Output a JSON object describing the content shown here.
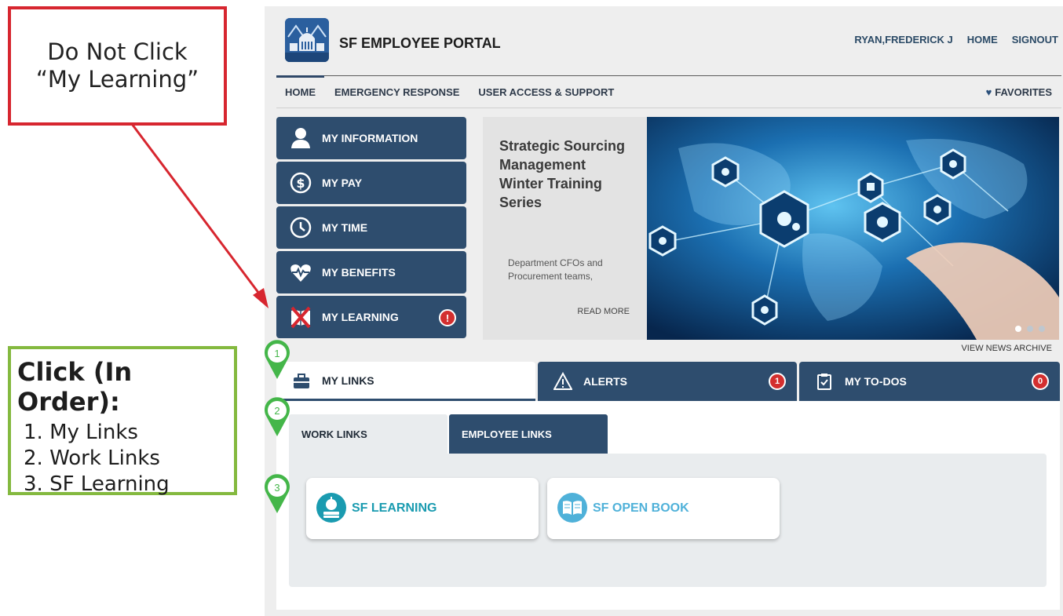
{
  "annotations": {
    "do_not_click": [
      "Do Not Click",
      "“My Learning”"
    ],
    "click_heading": "Click (In Order):",
    "steps": [
      "1. My Links",
      "2. Work Links",
      "3. SF Learning"
    ],
    "pins": [
      "1",
      "2",
      "3"
    ],
    "colors": {
      "red": "#d7262f",
      "green": "#84b93f",
      "pin": "#44b649"
    }
  },
  "header": {
    "brand": "SF EMPLOYEE PORTAL",
    "user": "RYAN,FREDERICK J",
    "home": "HOME",
    "signout": "SIGNOUT"
  },
  "nav": {
    "tabs": [
      "HOME",
      "EMERGENCY RESPONSE",
      "USER ACCESS & SUPPORT"
    ],
    "favorites": "FAVORITES"
  },
  "menu": {
    "items": [
      {
        "label": "MY INFORMATION",
        "icon": "person-icon"
      },
      {
        "label": "MY PAY",
        "icon": "dollar-icon"
      },
      {
        "label": "MY TIME",
        "icon": "clock-icon"
      },
      {
        "label": "MY BENEFITS",
        "icon": "heartbeat-icon"
      },
      {
        "label": "MY LEARNING",
        "icon": "book-icon",
        "alert": "!"
      }
    ]
  },
  "news": {
    "title": "Strategic Sourcing Management Winter Training Series",
    "body": "Department CFOs and Procurement teams,",
    "read_more": "READ MORE",
    "archive": "VIEW NEWS ARCHIVE",
    "slide_count": 3,
    "active_slide": 1
  },
  "tabs": {
    "my_links": "MY LINKS",
    "alerts": "ALERTS",
    "alerts_count": "1",
    "todos": "MY TO-DOS",
    "todos_count": "0"
  },
  "links": {
    "work_links": "WORK LINKS",
    "employee_links": "EMPLOYEE LINKS",
    "cards": [
      {
        "label": "SF LEARNING",
        "color": "#1a9bb0"
      },
      {
        "label": "SF OPEN BOOK",
        "color": "#4fb1d9"
      }
    ]
  },
  "colors": {
    "navy": "#2e4d6e",
    "alert": "#d32f2f"
  }
}
